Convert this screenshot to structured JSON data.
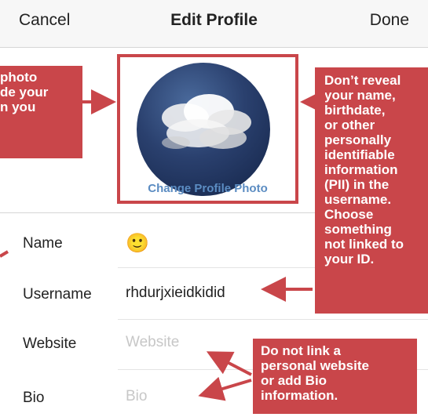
{
  "header": {
    "cancel_label": "Cancel",
    "title": "Edit Profile",
    "done_label": "Done"
  },
  "profile_photo": {
    "change_label": "Change Profile Photo"
  },
  "fields": {
    "name": {
      "label": "Name",
      "value": "🙂"
    },
    "username": {
      "label": "Username",
      "value": "rhdurjxieidkidid"
    },
    "website": {
      "label": "Website",
      "placeholder": "Website"
    },
    "bio": {
      "label": "Bio",
      "placeholder": "Bio"
    }
  },
  "callouts": {
    "left_photo": [
      "photo",
      "de your",
      "n you"
    ],
    "right_username": [
      "Don’t reveal",
      "your name,",
      "birthdate,",
      "or other",
      "personally",
      "identifiable",
      "information",
      "(PII) in the",
      "username.",
      "Choose",
      "something",
      "not linked to",
      "your ID."
    ],
    "bottom_website_bio": [
      "Do not link a",
      "personal website",
      "or add Bio",
      "information."
    ]
  },
  "colors": {
    "callout_red": "#c9464a",
    "link_blue": "#5b8cc2"
  }
}
